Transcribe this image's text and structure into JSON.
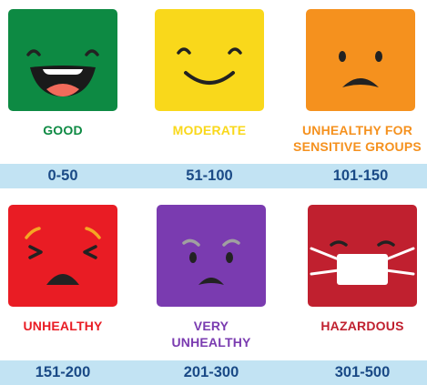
{
  "colors": {
    "good": "#0d8a43",
    "moderate": "#f9d81b",
    "sensitive": "#f5911e",
    "unhealthy": "#e91c24",
    "very_unhealthy": "#7a3bb0",
    "hazardous": "#c0202f",
    "band": "#c2e3f3",
    "range_text": "#1a4a86"
  },
  "categories": [
    {
      "label": "GOOD",
      "range": "0-50",
      "icon": "laughing-face-icon"
    },
    {
      "label": "MODERATE",
      "range": "51-100",
      "icon": "smiling-face-icon"
    },
    {
      "label": "UNHEALTHY FOR\nSENSITIVE GROUPS",
      "range": "101-150",
      "icon": "frowning-face-icon"
    },
    {
      "label": "UNHEALTHY",
      "range": "151-200",
      "icon": "squinting-sick-face-icon"
    },
    {
      "label": "VERY\nUNHEALTHY",
      "range": "201-300",
      "icon": "angry-face-icon"
    },
    {
      "label": "HAZARDOUS",
      "range": "301-500",
      "icon": "masked-face-icon"
    }
  ]
}
